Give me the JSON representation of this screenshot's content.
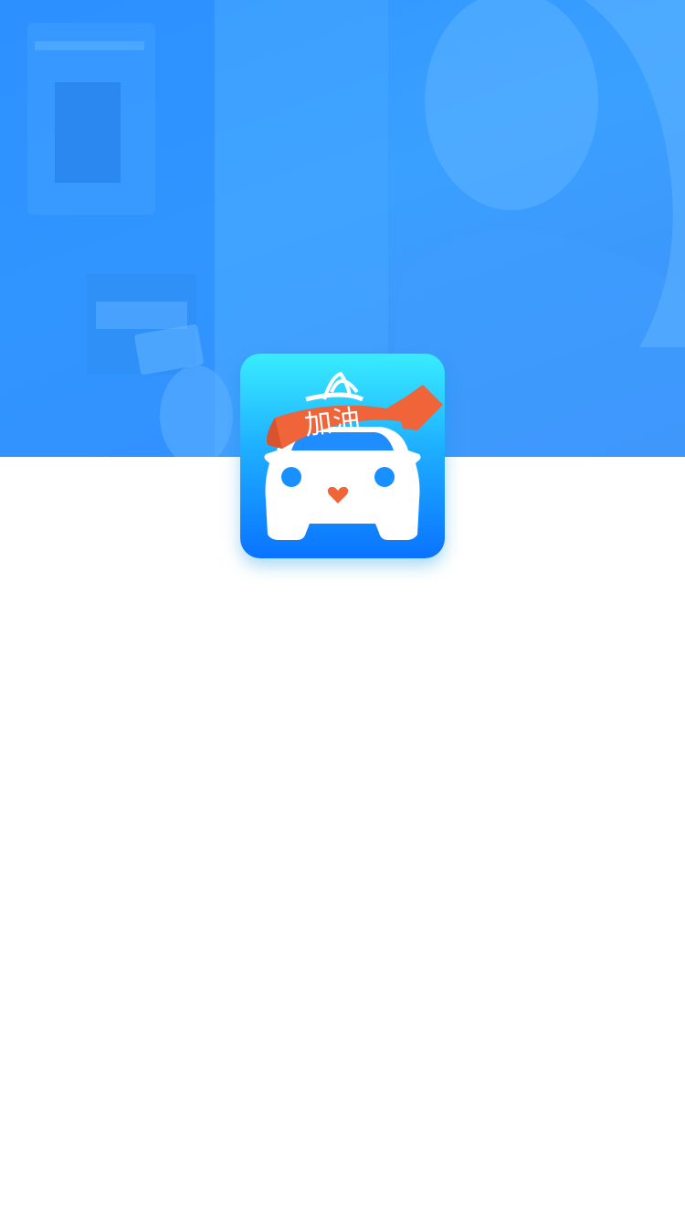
{
  "splash": {
    "app_icon": {
      "badge_text": "加油",
      "icon_name": "car-with-ribbon-icon"
    },
    "hero": {
      "image": "person-at-atm-blue-tint"
    }
  },
  "colors": {
    "hero_blue": "#3aa0ff",
    "icon_gradient_top": "#39ecff",
    "icon_gradient_bottom": "#0a73ff",
    "ribbon_orange": "#f0643a",
    "background": "#ffffff"
  }
}
